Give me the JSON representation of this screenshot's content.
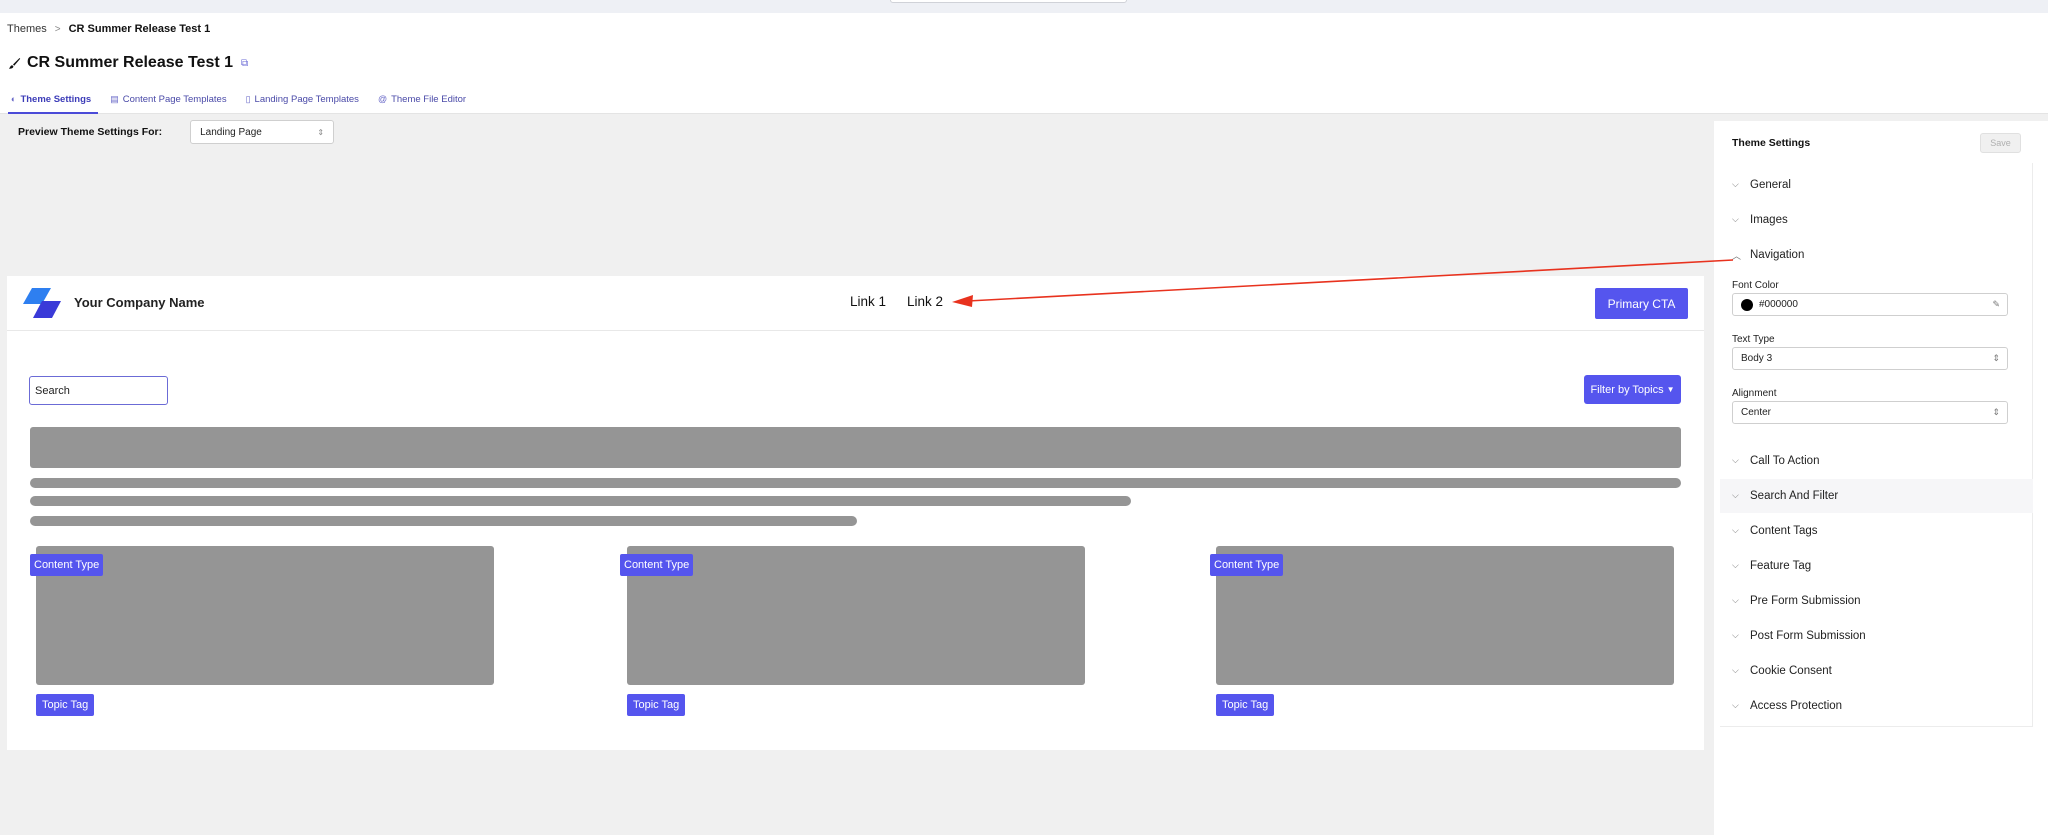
{
  "breadcrumb": {
    "parent": "Themes",
    "separator": ">",
    "current": "CR Summer Release Test 1"
  },
  "page": {
    "title": "CR Summer Release Test 1"
  },
  "tabs": [
    {
      "label": "Theme Settings",
      "icon": "theme-icon",
      "active": true
    },
    {
      "label": "Content Page Templates",
      "icon": "template-icon",
      "active": false
    },
    {
      "label": "Landing Page Templates",
      "icon": "document-icon",
      "active": false
    },
    {
      "label": "Theme File Editor",
      "icon": "at-icon",
      "active": false
    }
  ],
  "preview": {
    "label": "Preview Theme Settings For:",
    "selected": "Landing Page"
  },
  "site": {
    "company": "Your Company Name",
    "links": [
      "Link 1",
      "Link 2"
    ],
    "cta": "Primary CTA",
    "search_placeholder": "Search",
    "filter_label": "Filter by Topics",
    "cards": [
      {
        "type": "Content Type",
        "tag": "Topic Tag"
      },
      {
        "type": "Content Type",
        "tag": "Topic Tag"
      },
      {
        "type": "Content Type",
        "tag": "Topic Tag"
      }
    ],
    "accent_color": "#5555ee"
  },
  "panel": {
    "title": "Theme Settings",
    "save": "Save",
    "sections_top": [
      "General",
      "Images",
      "Navigation"
    ],
    "navigation": {
      "font_color_label": "Font Color",
      "font_color_value": "#000000",
      "text_type_label": "Text Type",
      "text_type_value": "Body 3",
      "alignment_label": "Alignment",
      "alignment_value": "Center"
    },
    "sections_bottom": [
      "Call To Action",
      "Search And Filter",
      "Content Tags",
      "Feature Tag",
      "Pre Form Submission",
      "Post Form Submission",
      "Cookie Consent",
      "Access Protection"
    ]
  },
  "annotation": {
    "arrow_color": "#e8321e"
  }
}
